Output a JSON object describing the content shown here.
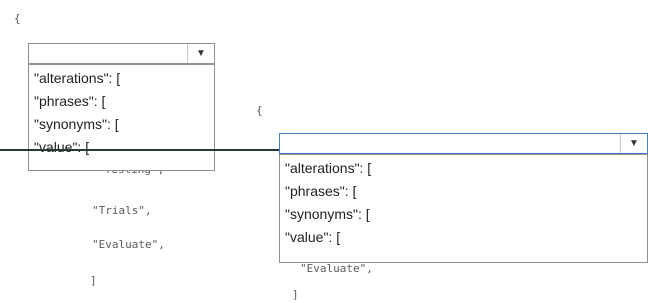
{
  "left": {
    "open_brace": "{",
    "snippet": [
      "\"Testing\",",
      "\"Trials\",",
      "\"Evaluate\",",
      "]"
    ],
    "dropdown": {
      "selected": "",
      "options": [
        "\"alterations\": [",
        "\"phrases\": [",
        "\"synonyms\": [",
        "\"value\": ["
      ]
    }
  },
  "right": {
    "open_brace": "{",
    "snippet": [
      "\"Evaluate\",",
      "]"
    ],
    "dropdown": {
      "selected": "",
      "options": [
        "\"alterations\": [",
        "\"phrases\": [",
        "\"synonyms\": [",
        "\"value\": ["
      ]
    }
  },
  "icons": {
    "dropdown_arrow": "triangle-down"
  }
}
